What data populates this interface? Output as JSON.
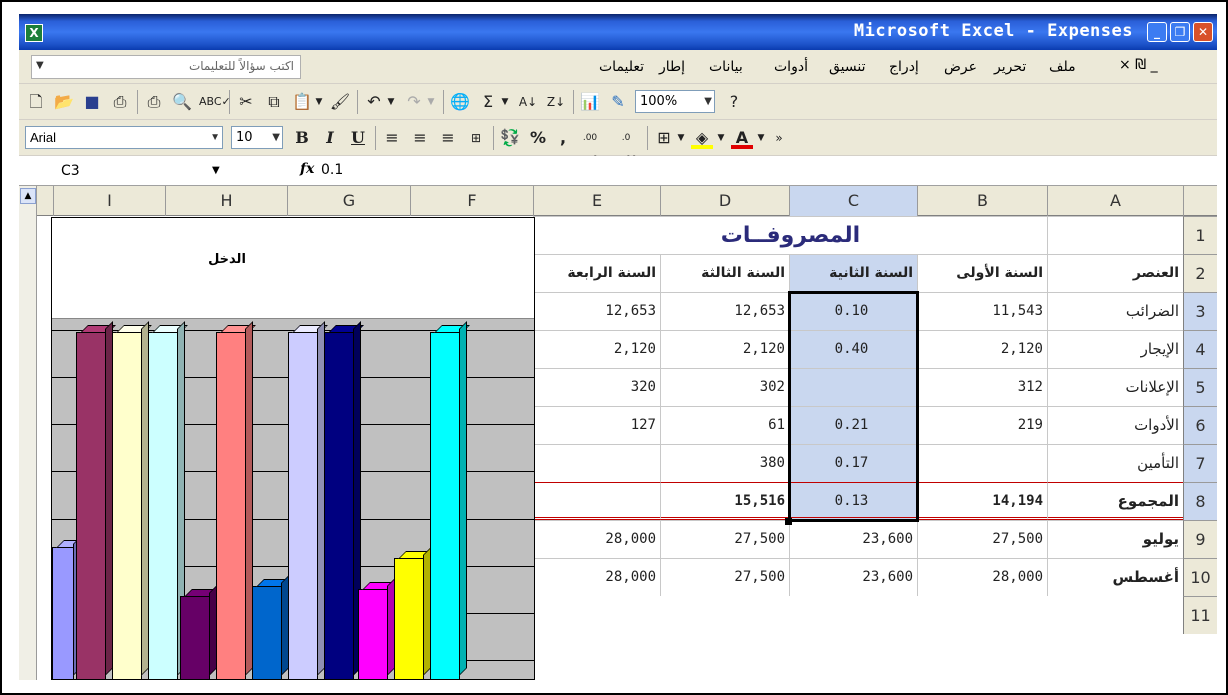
{
  "window": {
    "app_icon": "X",
    "title": "Microsoft Excel - Expenses",
    "min_label": "_",
    "restore_label": "❐",
    "close_label": "✕"
  },
  "menubar": {
    "help_placeholder": "اكتب سؤالاً للتعليمات",
    "menus": [
      "ملف",
      "تحرير",
      "عرض",
      "إدراج",
      "تنسيق",
      "أدوات",
      "بيانات",
      "إطار",
      "تعليمات"
    ],
    "doc_controls": "× ₪ _"
  },
  "toolbar_standard": {
    "zoom": "100%",
    "icons": [
      "new-icon",
      "open-icon",
      "save-icon",
      "permission-icon",
      "print-icon",
      "print-preview-icon",
      "spelling-icon",
      "cut-icon",
      "copy-icon",
      "paste-icon",
      "format-painter-icon",
      "undo-icon",
      "redo-icon",
      "hyperlink-icon",
      "autosum-icon",
      "sort-ascending-icon",
      "sort-descending-icon",
      "chart-wizard-icon",
      "drawing-icon",
      "help-icon"
    ]
  },
  "toolbar_format": {
    "font": "Arial",
    "size": "10",
    "bold": "B",
    "italic": "I",
    "underline": "U",
    "percent": "%",
    "comma": ",",
    "inc_decimal": ".00 →.0",
    "dec_decimal": ".0 →.00",
    "font_color_label": "A"
  },
  "formula_bar": {
    "name_box": "C3",
    "fx": "fx",
    "value": "0.1"
  },
  "sheet": {
    "columns": [
      "I",
      "H",
      "G",
      "F",
      "E",
      "D",
      "C",
      "B",
      "A"
    ],
    "rows": [
      "1",
      "2",
      "3",
      "4",
      "5",
      "6",
      "7",
      "8",
      "9",
      "10",
      "11"
    ],
    "title": "المصروفــات",
    "headers": {
      "A": "العنصر",
      "B": "السنة الأولى",
      "C": "السنة الثانية",
      "D": "السنة الثالثة",
      "E": "السنة الرابعة"
    },
    "data": [
      {
        "A": "الضرائب",
        "B": "11,543",
        "C": "0.10",
        "D": "12,653",
        "E": "12,653"
      },
      {
        "A": "الإيجار",
        "B": "2,120",
        "C": "0.40",
        "D": "2,120",
        "E": "2,120"
      },
      {
        "A": "الإعلانات",
        "B": "312",
        "C": "",
        "D": "302",
        "E": "320"
      },
      {
        "A": "الأدوات",
        "B": "219",
        "C": "0.21",
        "D": "61",
        "E": "127"
      },
      {
        "A": "التأمين",
        "B": "",
        "C": "0.17",
        "D": "380",
        "E": ""
      },
      {
        "A": "المجموع",
        "B": "14,194",
        "C": "0.13",
        "D": "15,516",
        "E": ""
      },
      {
        "A": "يوليو",
        "B": "27,500",
        "C": "23,600",
        "D": "27,500",
        "E": "28,000"
      },
      {
        "A": "أغسطس",
        "B": "28,000",
        "C": "23,600",
        "D": "27,500",
        "E": "28,000"
      }
    ]
  },
  "chart": {
    "title": "الدخل",
    "bar_colors": [
      "#9999ff",
      "#993366",
      "#ffffcc",
      "#ccffff",
      "#660066",
      "#ff8080",
      "#0066cc",
      "#ccccff",
      "#000080",
      "#ff00ff",
      "#ffff00",
      "#00ffff"
    ],
    "bar_levels": [
      0.38,
      0.99,
      0.99,
      0.99,
      0.24,
      0.99,
      0.27,
      0.99,
      0.99,
      0.26,
      0.35,
      0.99
    ]
  }
}
